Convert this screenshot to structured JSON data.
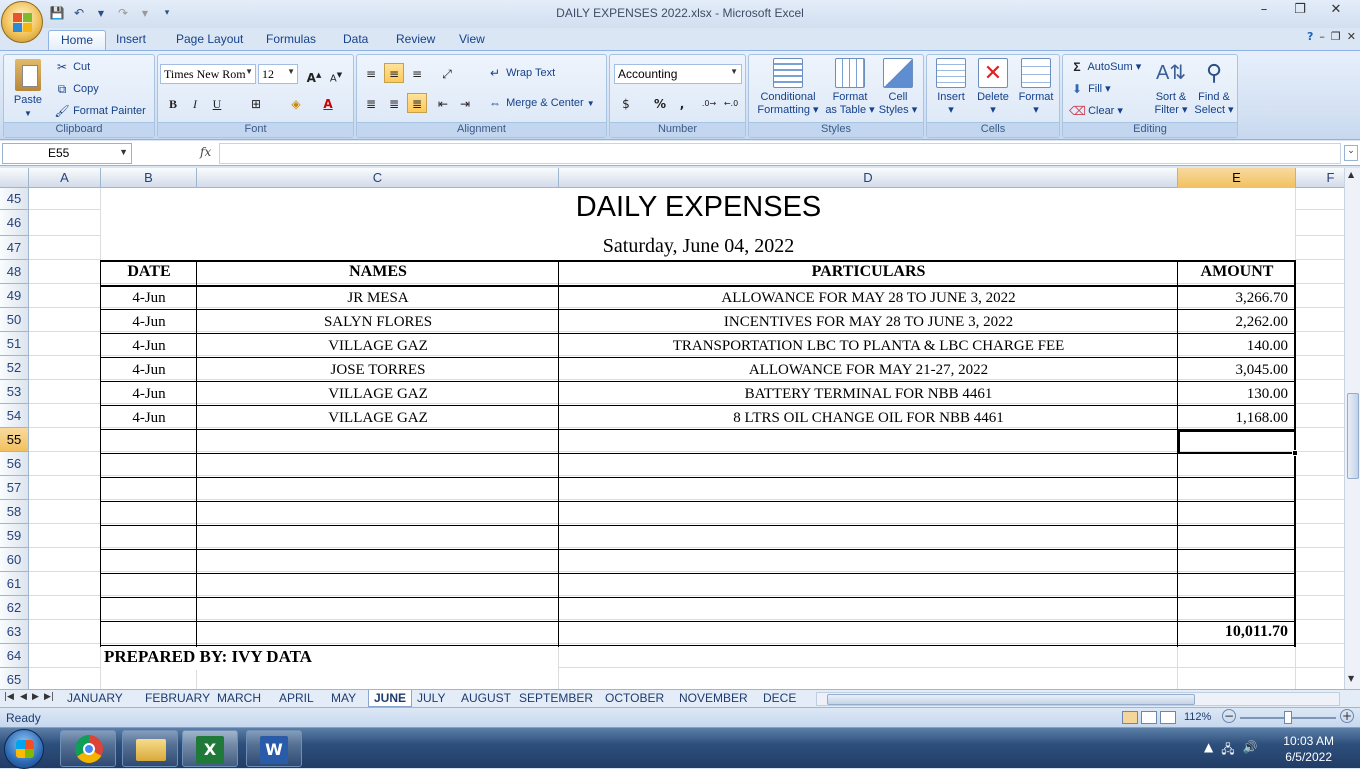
{
  "window": {
    "title": "DAILY EXPENSES 2022.xlsx - Microsoft Excel"
  },
  "ribbon_tabs": [
    "Home",
    "Insert",
    "Page Layout",
    "Formulas",
    "Data",
    "Review",
    "View"
  ],
  "clipboard": {
    "paste": "Paste",
    "cut": "Cut",
    "copy": "Copy",
    "format_painter": "Format Painter",
    "label": "Clipboard"
  },
  "font": {
    "name": "Times New Rom",
    "size": "12",
    "bold": "B",
    "italic": "I",
    "underline": "U",
    "label": "Font"
  },
  "alignment": {
    "wrap": "Wrap Text",
    "merge": "Merge & Center",
    "label": "Alignment"
  },
  "number": {
    "format": "Accounting",
    "percent": "%",
    "comma": ",",
    "label": "Number"
  },
  "styles": {
    "cond1": "Conditional",
    "cond2": "Formatting",
    "fmt1": "Format",
    "fmt2": "as Table",
    "cell1": "Cell",
    "cell2": "Styles",
    "label": "Styles"
  },
  "cells": {
    "insert": "Insert",
    "delete": "Delete",
    "format": "Format",
    "label": "Cells"
  },
  "editing": {
    "autosum": "AutoSum",
    "fill": "Fill",
    "clear": "Clear",
    "sort1": "Sort &",
    "sort2": "Filter",
    "find1": "Find &",
    "find2": "Select",
    "label": "Editing"
  },
  "formula_bar": {
    "name_box": "E55",
    "fx": "fx",
    "content": ""
  },
  "columns": [
    "A",
    "B",
    "C",
    "D",
    "E",
    "F"
  ],
  "rows": [
    "45",
    "46",
    "47",
    "48",
    "49",
    "50",
    "51",
    "52",
    "53",
    "54",
    "55",
    "56",
    "57",
    "58",
    "59",
    "60",
    "61",
    "62",
    "63",
    "64",
    "65"
  ],
  "sheet": {
    "title": "DAILY EXPENSES",
    "date": "Saturday, June 04, 2022",
    "headers": [
      "DATE",
      "NAMES",
      "PARTICULARS",
      "AMOUNT"
    ],
    "entries": [
      {
        "date": "4-Jun",
        "name": "JR MESA",
        "particulars": "ALLOWANCE FOR MAY 28 TO JUNE 3, 2022",
        "amount": "3,266.70"
      },
      {
        "date": "4-Jun",
        "name": "SALYN FLORES",
        "particulars": "INCENTIVES FOR MAY 28 TO JUNE 3, 2022",
        "amount": "2,262.00"
      },
      {
        "date": "4-Jun",
        "name": "VILLAGE GAZ",
        "particulars": "TRANSPORTATION LBC TO PLANTA & LBC CHARGE FEE",
        "amount": "140.00"
      },
      {
        "date": "4-Jun",
        "name": "JOSE TORRES",
        "particulars": "ALLOWANCE FOR MAY 21-27, 2022",
        "amount": "3,045.00"
      },
      {
        "date": "4-Jun",
        "name": "VILLAGE GAZ",
        "particulars": "BATTERY TERMINAL FOR NBB 4461",
        "amount": "130.00"
      },
      {
        "date": "4-Jun",
        "name": "VILLAGE GAZ",
        "particulars": "8 LTRS OIL CHANGE OIL FOR NBB 4461",
        "amount": "1,168.00"
      }
    ],
    "total": "10,011.70",
    "prepared_by": "PREPARED BY: IVY DATA"
  },
  "sheet_tabs": [
    "JANUARY",
    "FEBRUARY",
    "MARCH",
    "APRIL",
    "MAY",
    "JUNE",
    "JULY",
    "AUGUST",
    "SEPTEMBER",
    "OCTOBER",
    "NOVEMBER",
    "DECE"
  ],
  "active_sheet": "JUNE",
  "status": {
    "ready": "Ready",
    "zoom": "112%"
  },
  "clock": {
    "time": "10:03 AM",
    "date": "6/5/2022"
  }
}
